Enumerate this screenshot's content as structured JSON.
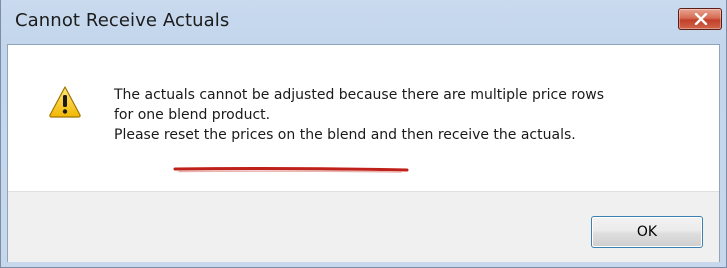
{
  "dialog": {
    "title": "Cannot Receive Actuals",
    "close_icon": "close-icon",
    "message_icon": "warning-icon",
    "message": {
      "line1": "The actuals cannot be adjusted because there are multiple price rows",
      "line2": "for one blend product.",
      "line3_prefix": "Please ",
      "line3_emphasis": "reset the prices on the blend",
      "line3_suffix": " and then receive the actuals."
    },
    "ok_label": "OK"
  },
  "colors": {
    "annotation_underline": "#c0201a",
    "close_button": "#c2402a",
    "titlebar": "#c3d6ec",
    "footer": "#f0f0f0"
  }
}
